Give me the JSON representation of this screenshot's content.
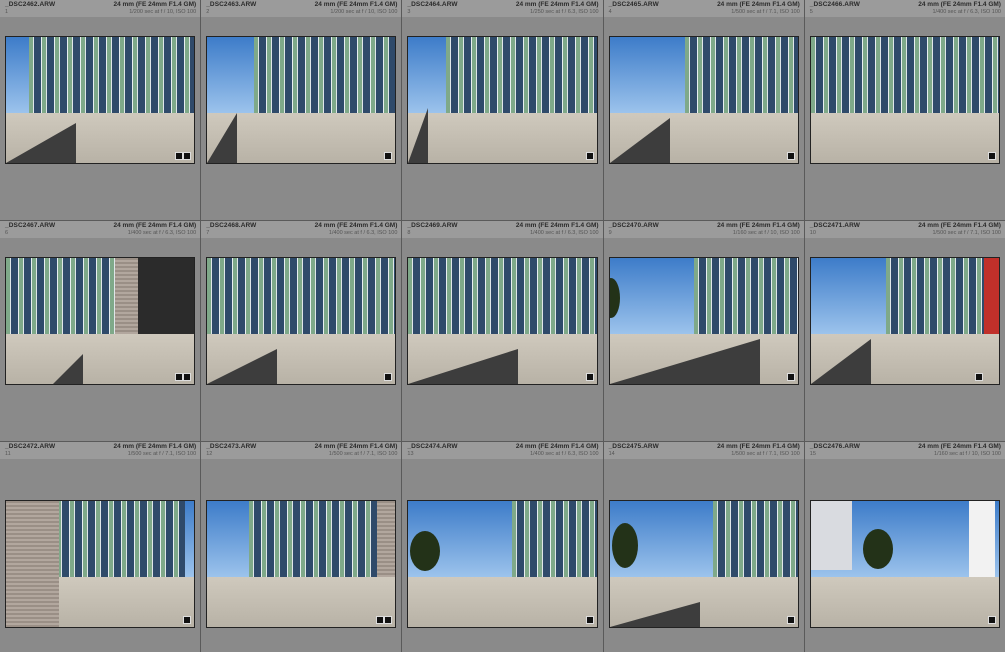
{
  "thumbnails": [
    {
      "file": "_DSC2462.ARW",
      "index": "1",
      "lens": "24 mm (FE 24mm F1.4 GM)",
      "exif": "1/200 sec at f / 10, ISO 100",
      "badges": 2
    },
    {
      "file": "_DSC2463.ARW",
      "index": "2",
      "lens": "24 mm (FE 24mm F1.4 GM)",
      "exif": "1/200 sec at f / 10, ISO 100",
      "badges": 1
    },
    {
      "file": "_DSC2464.ARW",
      "index": "3",
      "lens": "24 mm (FE 24mm F1.4 GM)",
      "exif": "1/250 sec at f / 6.3, ISO 100",
      "badges": 1
    },
    {
      "file": "_DSC2465.ARW",
      "index": "4",
      "lens": "24 mm (FE 24mm F1.4 GM)",
      "exif": "1/500 sec at f / 7.1, ISO 100",
      "badges": 1
    },
    {
      "file": "_DSC2466.ARW",
      "index": "5",
      "lens": "24 mm (FE 24mm F1.4 GM)",
      "exif": "1/400 sec at f / 6.3, ISO 100",
      "badges": 1
    },
    {
      "file": "_DSC2467.ARW",
      "index": "6",
      "lens": "24 mm (FE 24mm F1.4 GM)",
      "exif": "1/400 sec at f / 6.3, ISO 100",
      "badges": 2
    },
    {
      "file": "_DSC2468.ARW",
      "index": "7",
      "lens": "24 mm (FE 24mm F1.4 GM)",
      "exif": "1/400 sec at f / 6.3, ISO 100",
      "badges": 1
    },
    {
      "file": "_DSC2469.ARW",
      "index": "8",
      "lens": "24 mm (FE 24mm F1.4 GM)",
      "exif": "1/400 sec at f / 6.3, ISO 100",
      "badges": 1
    },
    {
      "file": "_DSC2470.ARW",
      "index": "9",
      "lens": "24 mm (FE 24mm F1.4 GM)",
      "exif": "1/160 sec at f / 10, ISO 100",
      "badges": 1
    },
    {
      "file": "_DSC2471.ARW",
      "index": "10",
      "lens": "24 mm (FE 24mm F1.4 GM)",
      "exif": "1/500 sec at f / 7.1, ISO 100",
      "badges": 1
    },
    {
      "file": "_DSC2472.ARW",
      "index": "11",
      "lens": "24 mm (FE 24mm F1.4 GM)",
      "exif": "1/500 sec at f / 7.1, ISO 100",
      "badges": 1
    },
    {
      "file": "_DSC2473.ARW",
      "index": "12",
      "lens": "24 mm (FE 24mm F1.4 GM)",
      "exif": "1/500 sec at f / 7.1, ISO 100",
      "badges": 2
    },
    {
      "file": "_DSC2474.ARW",
      "index": "13",
      "lens": "24 mm (FE 24mm F1.4 GM)",
      "exif": "1/400 sec at f / 6.3, ISO 100",
      "badges": 1
    },
    {
      "file": "_DSC2475.ARW",
      "index": "14",
      "lens": "24 mm (FE 24mm F1.4 GM)",
      "exif": "1/500 sec at f / 7.1, ISO 100",
      "badges": 1
    },
    {
      "file": "_DSC2476.ARW",
      "index": "15",
      "lens": "24 mm (FE 24mm F1.4 GM)",
      "exif": "1/160 sec at f / 10, ISO 100",
      "badges": 1
    }
  ],
  "icons": {
    "edit_badge": "edit-badge-icon",
    "crop_badge": "crop-badge-icon"
  }
}
